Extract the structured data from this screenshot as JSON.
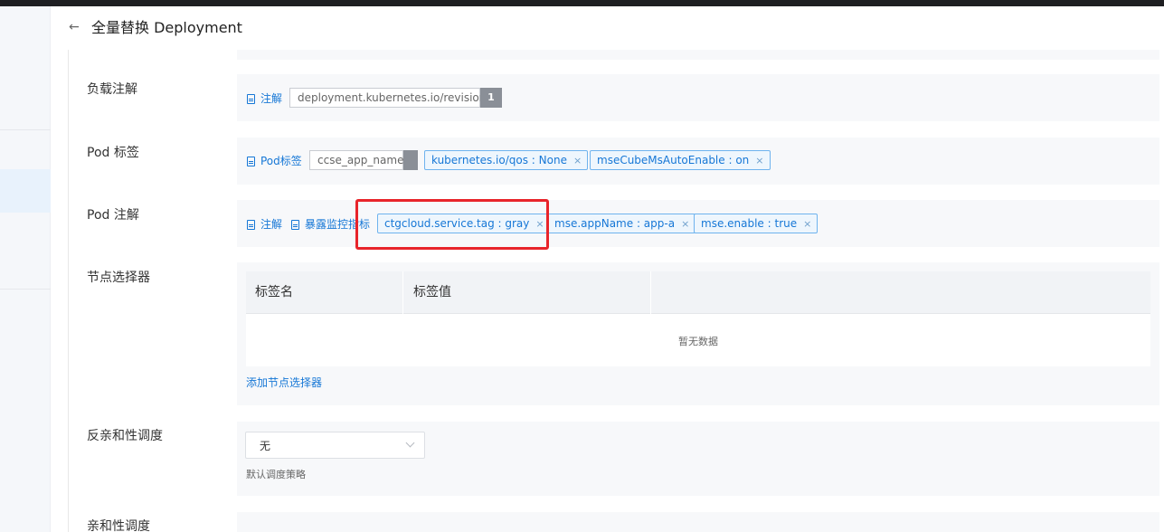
{
  "header": {
    "back_icon": "arrow-left-icon",
    "title": "全量替换 Deployment"
  },
  "rows": {
    "workload_annotation": {
      "label": "负载注解",
      "link": "注解",
      "input_value": "deployment.kubernetes.io/revision",
      "addon": "1"
    },
    "pod_labels": {
      "label": "Pod 标签",
      "link": "Pod标签",
      "input_value": "ccse_app_name",
      "tags": [
        "kubernetes.io/qos : None",
        "mseCubeMsAutoEnable : on"
      ]
    },
    "pod_annotations": {
      "label": "Pod 注解",
      "link_annotation": "注解",
      "link_expose": "暴露监控指标",
      "tags": [
        "ctgcloud.service.tag : gray",
        "mse.appName : app-a",
        "mse.enable : true"
      ]
    },
    "node_selector": {
      "label": "节点选择器",
      "columns": [
        "标签名",
        "标签值"
      ],
      "empty_text": "暂无数据",
      "add_link": "添加节点选择器"
    },
    "anti_affinity": {
      "label": "反亲和性调度",
      "selected": "无",
      "hint": "默认调度策略"
    },
    "affinity": {
      "label": "亲和性调度"
    }
  },
  "tag_close_glyph": "×",
  "colors": {
    "accent": "#1677d6",
    "highlight": "#e8242a"
  }
}
